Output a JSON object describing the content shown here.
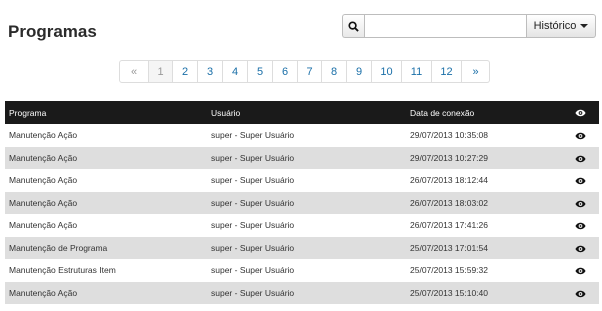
{
  "header": {
    "title": "Programas"
  },
  "search": {
    "value": "",
    "placeholder": ""
  },
  "history_button": {
    "label": "Histórico"
  },
  "pagination": {
    "prev": "«",
    "next": "»",
    "pages": [
      "1",
      "2",
      "3",
      "4",
      "5",
      "6",
      "7",
      "8",
      "9",
      "10",
      "11",
      "12"
    ],
    "current": "1"
  },
  "table": {
    "columns": {
      "program": "Programa",
      "user": "Usuário",
      "date": "Data de conexão"
    },
    "rows": [
      {
        "program": "Manutenção Ação",
        "user": "super - Super Usuário",
        "date": "29/07/2013 10:35:08"
      },
      {
        "program": "Manutenção Ação",
        "user": "super - Super Usuário",
        "date": "29/07/2013 10:27:29"
      },
      {
        "program": "Manutenção Ação",
        "user": "super - Super Usuário",
        "date": "26/07/2013 18:12:44"
      },
      {
        "program": "Manutenção Ação",
        "user": "super - Super Usuário",
        "date": "26/07/2013 18:03:02"
      },
      {
        "program": "Manutenção Ação",
        "user": "super - Super Usuário",
        "date": "26/07/2013 17:41:26"
      },
      {
        "program": "Manutenção de Programa",
        "user": "super - Super Usuário",
        "date": "25/07/2013 17:01:54"
      },
      {
        "program": "Manutenção Estruturas Item",
        "user": "super - Super Usuário",
        "date": "25/07/2013 15:59:32"
      },
      {
        "program": "Manutenção Ação",
        "user": "super - Super Usuário",
        "date": "25/07/2013 15:10:40"
      }
    ]
  },
  "icons": {
    "search": "search-icon",
    "eye": "eye-icon",
    "caret": "chevron-down-icon"
  },
  "colors": {
    "header_bg": "#1a1a1a",
    "link": "#1a6fa8",
    "row_alt": "#dedede"
  }
}
